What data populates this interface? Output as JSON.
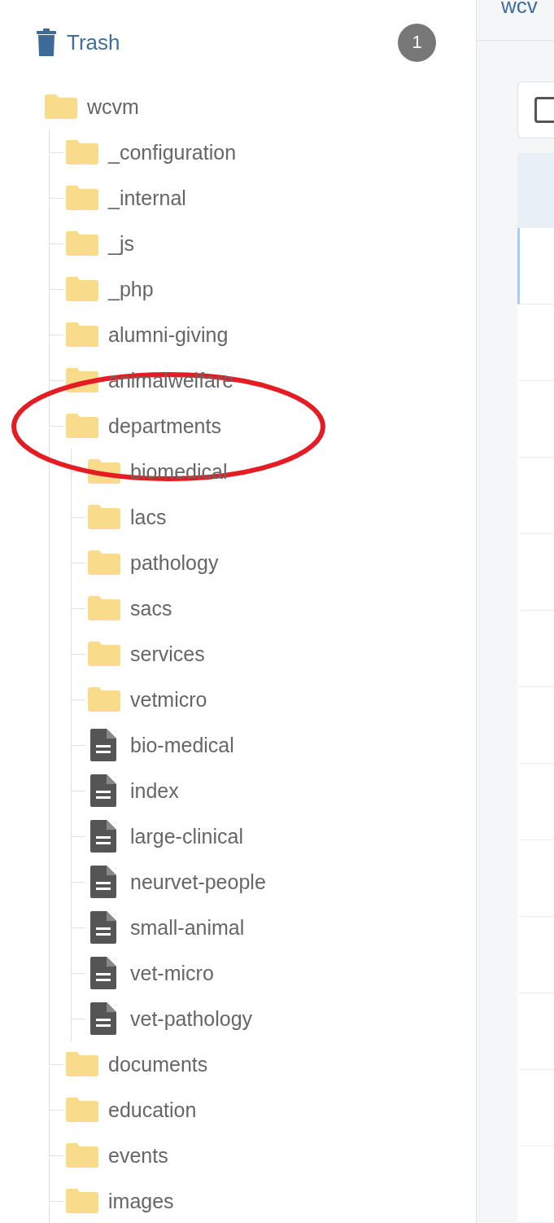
{
  "sidebar": {
    "trash": {
      "label": "Trash",
      "count": "1"
    },
    "tree": [
      {
        "kind": "folder",
        "label": "wcvm",
        "children": [
          {
            "kind": "folder",
            "label": "_configuration"
          },
          {
            "kind": "folder",
            "label": "_internal"
          },
          {
            "kind": "folder",
            "label": "_js"
          },
          {
            "kind": "folder",
            "label": "_php"
          },
          {
            "kind": "folder",
            "label": "alumni-giving"
          },
          {
            "kind": "folder",
            "label": "animalwelfare"
          },
          {
            "kind": "folder",
            "label": "departments",
            "circled": true,
            "children": [
              {
                "kind": "folder",
                "label": "biomedical"
              },
              {
                "kind": "folder",
                "label": "lacs"
              },
              {
                "kind": "folder",
                "label": "pathology"
              },
              {
                "kind": "folder",
                "label": "sacs"
              },
              {
                "kind": "folder",
                "label": "services"
              },
              {
                "kind": "folder",
                "label": "vetmicro"
              },
              {
                "kind": "file",
                "label": "bio-medical"
              },
              {
                "kind": "file",
                "label": "index"
              },
              {
                "kind": "file",
                "label": "large-clinical"
              },
              {
                "kind": "file",
                "label": "neurvet-people"
              },
              {
                "kind": "file",
                "label": "small-animal"
              },
              {
                "kind": "file",
                "label": "vet-micro"
              },
              {
                "kind": "file",
                "label": "vet-pathology"
              }
            ]
          },
          {
            "kind": "folder",
            "label": "documents"
          },
          {
            "kind": "folder",
            "label": "education"
          },
          {
            "kind": "folder",
            "label": "events"
          },
          {
            "kind": "folder",
            "label": "images"
          }
        ]
      }
    ]
  },
  "main": {
    "title": "wcv",
    "select_all": {
      "checked": false
    },
    "rows": [
      {
        "selected": true
      },
      {
        "selected": false
      },
      {
        "selected": false
      },
      {
        "selected": false
      },
      {
        "selected": false
      },
      {
        "selected": false
      },
      {
        "selected": false
      },
      {
        "selected": false
      },
      {
        "selected": false
      },
      {
        "selected": false
      },
      {
        "selected": false
      },
      {
        "selected": false
      },
      {
        "selected": false
      }
    ]
  }
}
